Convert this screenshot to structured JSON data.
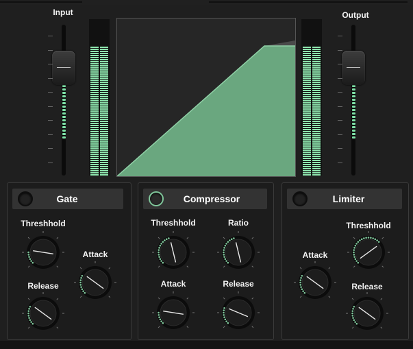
{
  "input": {
    "label": "Input",
    "level": 0.62
  },
  "output": {
    "label": "Output",
    "level": 0.62
  },
  "gate": {
    "title": "Gate",
    "enabled": false,
    "knobs": {
      "threshold": {
        "label": "Threshhold",
        "value": 0.2
      },
      "attack": {
        "label": "Attack",
        "value": 0.3
      },
      "release": {
        "label": "Release",
        "value": 0.3
      }
    }
  },
  "compressor": {
    "title": "Compressor",
    "enabled": true,
    "knobs": {
      "threshold": {
        "label": "Threshhold",
        "value": 0.45
      },
      "ratio": {
        "label": "Ratio",
        "value": 0.45
      },
      "attack": {
        "label": "Attack",
        "value": 0.2
      },
      "release": {
        "label": "Release",
        "value": 0.25
      }
    }
  },
  "limiter": {
    "title": "Limiter",
    "enabled": false,
    "knobs": {
      "attack": {
        "label": "Attack",
        "value": 0.3
      },
      "threshold": {
        "label": "Threshhold",
        "value": 0.7
      },
      "release": {
        "label": "Release",
        "value": 0.3
      }
    }
  },
  "colors": {
    "accent": "#7fc59a",
    "curve_fill": "#6aa77f",
    "meter": "#8de4ad"
  }
}
